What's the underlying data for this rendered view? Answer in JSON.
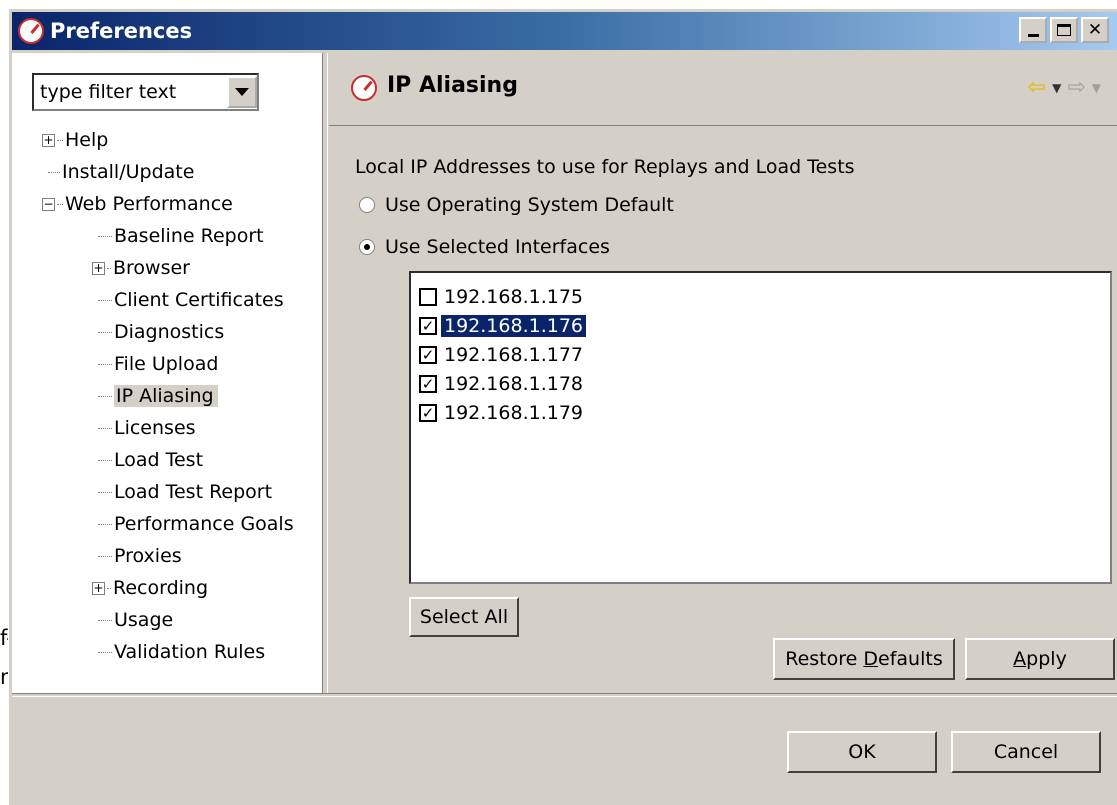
{
  "edge_fragments": [
    "f-",
    "n"
  ],
  "window": {
    "title": "Preferences"
  },
  "filter": {
    "text": "type filter text"
  },
  "tree": {
    "help": "Help",
    "install_update": "Install/Update",
    "web_performance": "Web Performance",
    "children": [
      "Baseline Report",
      "Browser",
      "Client Certificates",
      "Diagnostics",
      "File Upload",
      "IP Aliasing",
      "Licenses",
      "Load Test",
      "Load Test Report",
      "Performance Goals",
      "Proxies",
      "Recording",
      "Usage",
      "Validation Rules"
    ],
    "selected": "IP Aliasing"
  },
  "page": {
    "title": "IP Aliasing",
    "description": "Local IP Addresses to use for Replays and Load Tests",
    "radio_default": "Use Operating System Default",
    "radio_selected": "Use Selected Interfaces",
    "radio_choice": "Use Selected Interfaces",
    "interfaces": [
      {
        "ip": "192.168.1.175",
        "checked": false
      },
      {
        "ip": "192.168.1.176",
        "checked": true
      },
      {
        "ip": "192.168.1.177",
        "checked": true
      },
      {
        "ip": "192.168.1.178",
        "checked": true
      },
      {
        "ip": "192.168.1.179",
        "checked": true
      }
    ],
    "selected_interface": "192.168.1.176",
    "select_all": "Select All",
    "restore_defaults": "Restore Defaults",
    "apply": "Apply"
  },
  "dialog": {
    "ok": "OK",
    "cancel": "Cancel"
  },
  "colors": {
    "title_start": "#0a246a",
    "title_end": "#a6caf0",
    "face": "#d4d0c8",
    "highlight": "#0a246a",
    "nav_back": "#e6b800"
  }
}
